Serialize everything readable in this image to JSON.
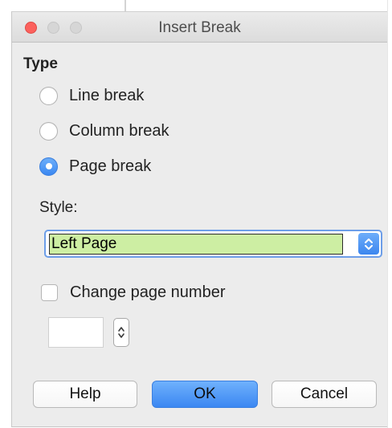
{
  "window": {
    "title": "Insert Break"
  },
  "type_section": {
    "heading": "Type",
    "options": [
      {
        "label": "Line break",
        "selected": false
      },
      {
        "label": "Column break",
        "selected": false
      },
      {
        "label": "Page break",
        "selected": true
      }
    ]
  },
  "style": {
    "label": "Style:",
    "selected_value": "Left Page"
  },
  "change_page_number": {
    "label": "Change page number",
    "checked": false,
    "value": ""
  },
  "buttons": {
    "help": "Help",
    "ok": "OK",
    "cancel": "Cancel"
  },
  "colors": {
    "accent": "#3b87f2",
    "close_button": "#fc615d",
    "style_highlight": "#cdeea3",
    "dialog_background": "#ececec"
  },
  "icons": {
    "close": "close-icon",
    "minimize": "minimize-icon",
    "maximize": "maximize-icon",
    "select_stepper": "up-down-chevron-icon",
    "number_stepper": "up-down-chevron-icon"
  }
}
